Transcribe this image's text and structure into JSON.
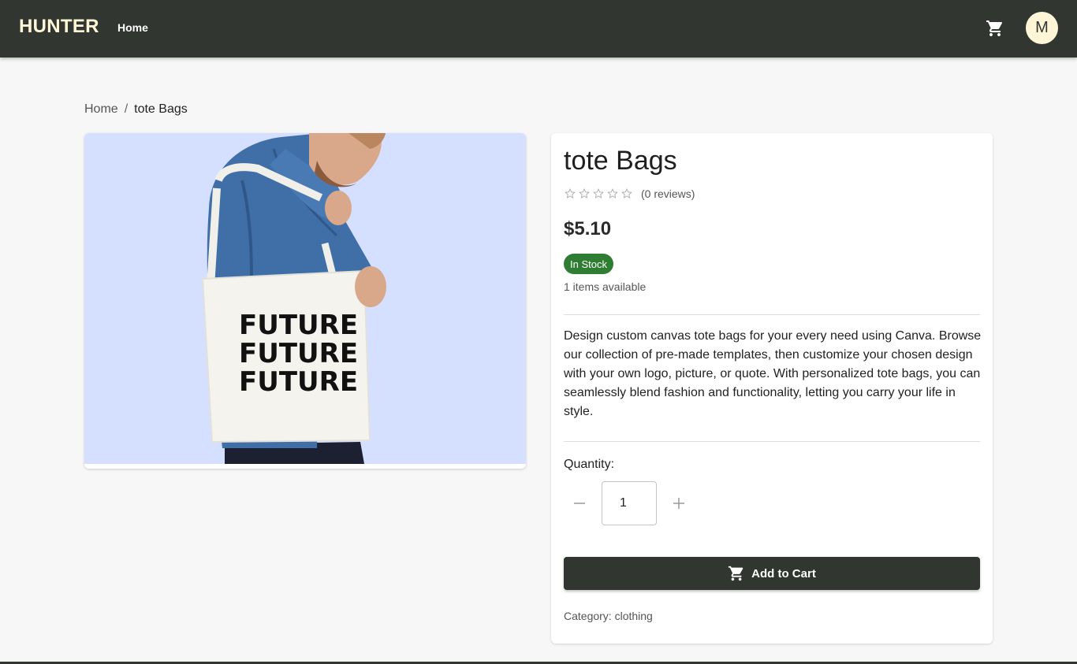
{
  "header": {
    "brand": "HUNTER",
    "nav_home": "Home",
    "avatar_initial": "M",
    "bg_color": "#313630",
    "accent_color": "#fff6d8"
  },
  "breadcrumb": {
    "home": "Home",
    "separator": "/",
    "current": "tote Bags"
  },
  "product": {
    "image_bg_color": "#d5dfff",
    "image_text_lines": [
      "FUTURE",
      "FUTURE",
      "FUTURE"
    ],
    "title": "tote Bags",
    "rating": 0,
    "rating_max": 5,
    "reviews": "(0 reviews)",
    "price": "$5.10",
    "stock_badge": "In Stock",
    "stock_color": "#2e7d32",
    "available": "1 items available",
    "description": "Design custom canvas tote bags for your every need using Canva. Browse our collection of pre-made templates, then customize your chosen design with your own logo, picture, or quote. With personalized tote bags, you can seamlessly blend fashion and functionality, letting you carry your life in style.",
    "quantity_label": "Quantity:",
    "quantity_value": "1",
    "add_to_cart": "Add to Cart",
    "category": "Category: clothing"
  },
  "icons": {
    "cart": "cart-icon",
    "minus": "minus-icon",
    "plus": "plus-icon",
    "star": "star-outline-icon"
  }
}
